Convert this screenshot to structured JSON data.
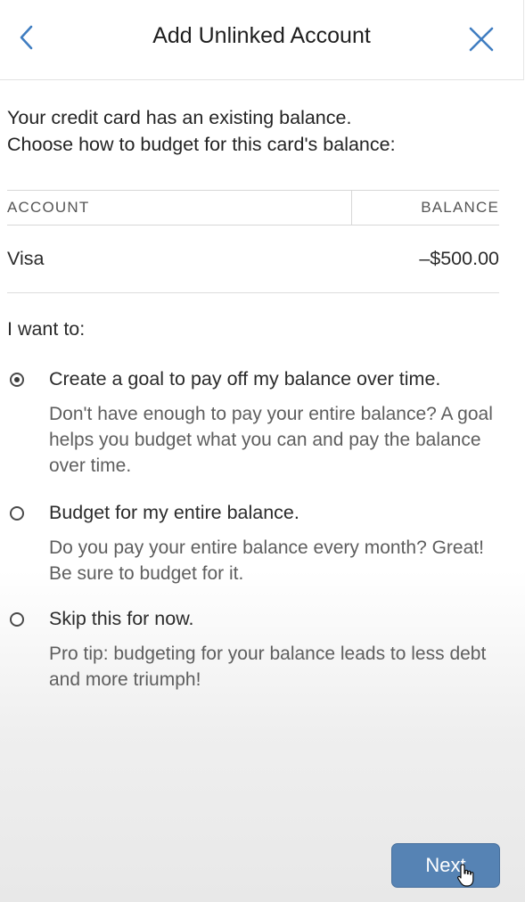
{
  "header": {
    "title": "Add Unlinked Account",
    "back_icon": "chevron-left-icon",
    "close_icon": "close-icon",
    "icon_color": "#3f7dc1"
  },
  "intro": {
    "line1": "Your credit card has an existing balance.",
    "line2": "Choose how to budget for this card's balance:"
  },
  "table": {
    "columns": [
      "ACCOUNT",
      "BALANCE"
    ],
    "rows": [
      {
        "account": "Visa",
        "balance": "–$500.00"
      }
    ]
  },
  "prompt": "I want to:",
  "options": [
    {
      "title": "Create a goal to pay off my balance over time.",
      "description": "Don't have enough to pay your entire balance? A goal helps you budget what you can and pay the balance over time.",
      "selected": true
    },
    {
      "title": "Budget for my entire balance.",
      "description": "Do you pay your entire balance every month? Great! Be sure to budget for it.",
      "selected": false
    },
    {
      "title": "Skip this for now.",
      "description": "Pro tip: budgeting for your balance leads to less debt and more triumph!",
      "selected": false
    }
  ],
  "footer": {
    "next_label": "Next",
    "button_color": "#5683b4"
  }
}
